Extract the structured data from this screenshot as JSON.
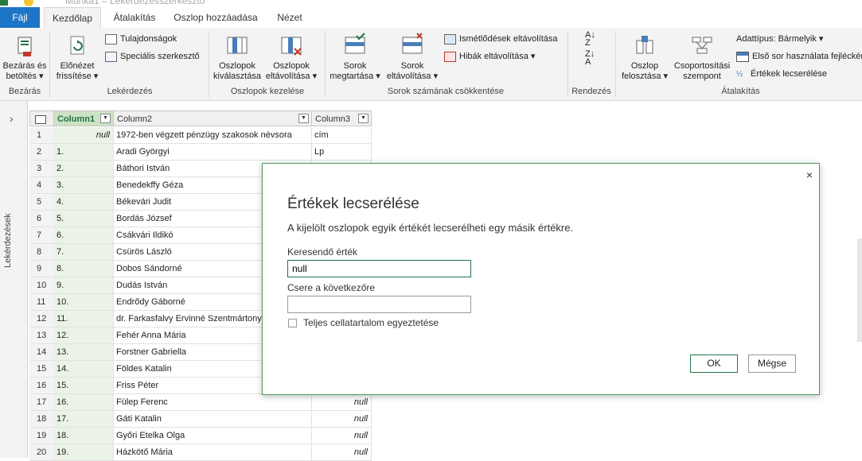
{
  "window": {
    "title": "Munka1 – Lekérdezésszerkesztő"
  },
  "tabs": [
    {
      "label": "Fájl"
    },
    {
      "label": "Kezdőlap"
    },
    {
      "label": "Átalakítás"
    },
    {
      "label": "Oszlop hozzáadása"
    },
    {
      "label": "Nézet"
    }
  ],
  "ribbon": {
    "groups": {
      "close": "Bezárás",
      "query": "Lekérdezés",
      "manage_columns": "Oszlopok kezelése",
      "reduce_rows": "Sorok számának csökkentése",
      "sort": "Rendezés",
      "transform": "Átalakítás"
    },
    "close_load": [
      "Bezárás és",
      "betöltés ▾"
    ],
    "refresh_preview": [
      "Előnézet",
      "frissítése ▾"
    ],
    "properties": "Tulajdonságok",
    "advanced_editor": "Speciális szerkesztő",
    "choose_columns": [
      "Oszlopok",
      "kiválasztása"
    ],
    "remove_columns": [
      "Oszlopok",
      "eltávolítása ▾"
    ],
    "keep_rows": [
      "Sorok",
      "megtartása ▾"
    ],
    "remove_rows": [
      "Sorok",
      "eltávolítása ▾"
    ],
    "remove_duplicates": "Ismétlődések eltávolítása",
    "remove_errors": "Hibák eltávolítása ▾",
    "split_column": [
      "Oszlop",
      "felosztása ▾"
    ],
    "group_by": [
      "Csoportosítási",
      "szempont"
    ],
    "data_type": "Adattípus: Bármelyik ▾",
    "use_first_row": "Első sor használata fejlécként",
    "replace_values": "Értékek lecserélése"
  },
  "left_pane": {
    "label": "Lekérdezések",
    "expand": "›"
  },
  "grid": {
    "columns": [
      "Column1",
      "Column2",
      "Column3"
    ],
    "rows": [
      {
        "n": "1",
        "c1": "null",
        "c2": "1972-ben végzett pénzügy szakosok névsora",
        "c3": "cím"
      },
      {
        "n": "2",
        "c1": "1.",
        "c2": "Aradi Györgyi",
        "c3": "Lp"
      },
      {
        "n": "3",
        "c1": "2.",
        "c2": "Báthori István",
        "c3": ""
      },
      {
        "n": "4",
        "c1": "3.",
        "c2": "Benedekffy Géza",
        "c3": ""
      },
      {
        "n": "5",
        "c1": "4.",
        "c2": "Békevári Judit",
        "c3": ""
      },
      {
        "n": "6",
        "c1": "5.",
        "c2": "Bordás József",
        "c3": ""
      },
      {
        "n": "7",
        "c1": "6.",
        "c2": "Csákvári Ildikó",
        "c3": ""
      },
      {
        "n": "8",
        "c1": "7.",
        "c2": "Csürös László",
        "c3": ""
      },
      {
        "n": "9",
        "c1": "8.",
        "c2": "Dobos Sándorné",
        "c3": ""
      },
      {
        "n": "10",
        "c1": "9.",
        "c2": "Dudás István",
        "c3": ""
      },
      {
        "n": "11",
        "c1": "10.",
        "c2": "Endrődy Gáborné",
        "c3": ""
      },
      {
        "n": "12",
        "c1": "11.",
        "c2": "dr. Farkasfalvy Ervinné Szentmártony",
        "c3": ""
      },
      {
        "n": "13",
        "c1": "12.",
        "c2": "Fehér Anna Mária",
        "c3": ""
      },
      {
        "n": "14",
        "c1": "13.",
        "c2": "Forstner Gabriella",
        "c3": ""
      },
      {
        "n": "15",
        "c1": "14.",
        "c2": "Földes Katalin",
        "c3": ""
      },
      {
        "n": "16",
        "c1": "15.",
        "c2": "Friss Péter",
        "c3": ""
      },
      {
        "n": "17",
        "c1": "16.",
        "c2": "Fülep Ferenc",
        "c3": "null"
      },
      {
        "n": "18",
        "c1": "17.",
        "c2": "Gáti Katalin",
        "c3": "null"
      },
      {
        "n": "19",
        "c1": "18.",
        "c2": "Győri Etelka Olga",
        "c3": "null"
      },
      {
        "n": "20",
        "c1": "19.",
        "c2": "Házkötő Mária",
        "c3": "null"
      }
    ]
  },
  "dialog": {
    "title": "Értékek lecserélése",
    "description": "A kijelölt oszlopok egyik értékét lecserélheti egy másik értékre.",
    "find_label": "Keresendő érték",
    "find_value": "null",
    "replace_label": "Csere a következőre",
    "replace_value": "",
    "match_label": "Teljes cellatartalom egyeztetése",
    "ok": "OK",
    "cancel": "Mégse",
    "close": "×"
  },
  "colors": {
    "accent": "#217346",
    "file_tab": "#1e74c6"
  }
}
